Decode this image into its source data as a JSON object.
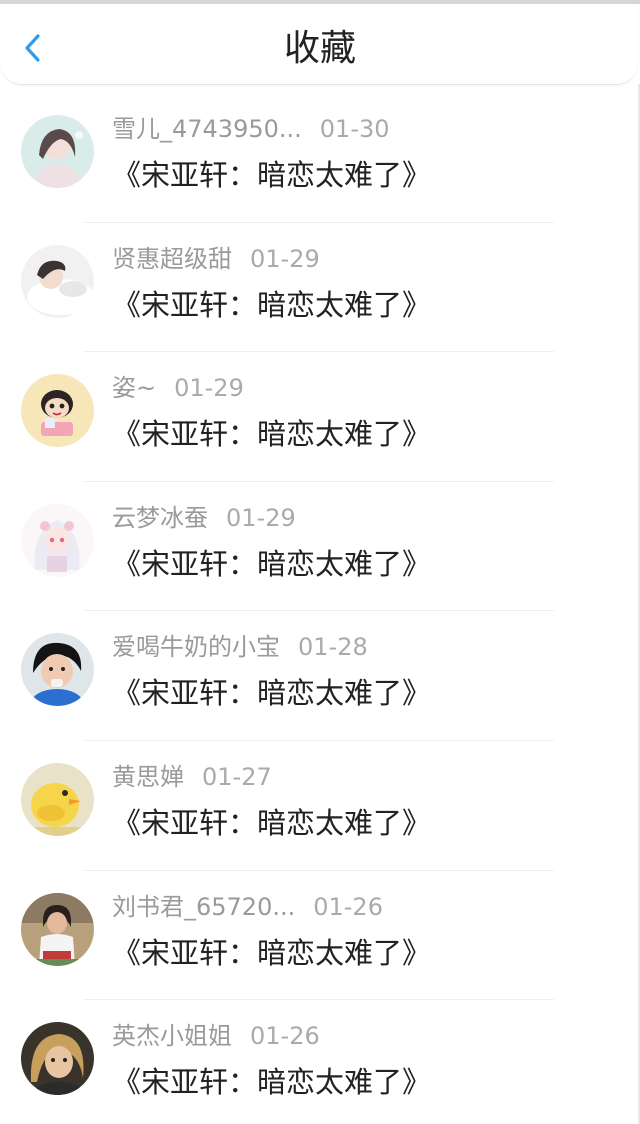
{
  "header": {
    "title": "收藏"
  },
  "accent_color": "#2f9bf0",
  "items": [
    {
      "user": "雪儿_4743950...",
      "date": "01-30",
      "title": "《宋亚轩：暗恋太难了》",
      "avatar": "avatar-girl-pale"
    },
    {
      "user": "贤惠超级甜",
      "date": "01-29",
      "title": "《宋亚轩：暗恋太难了》",
      "avatar": "avatar-sleeping-person"
    },
    {
      "user": "姿~",
      "date": "01-29",
      "title": "《宋亚轩：暗恋太难了》",
      "avatar": "avatar-cartoon-character"
    },
    {
      "user": "云梦冰蚕",
      "date": "01-29",
      "title": "《宋亚轩：暗恋太难了》",
      "avatar": "avatar-anime-girl"
    },
    {
      "user": "爱喝牛奶的小宝",
      "date": "01-28",
      "title": "《宋亚轩：暗恋太难了》",
      "avatar": "avatar-boy"
    },
    {
      "user": "黄思婵",
      "date": "01-27",
      "title": "《宋亚轩：暗恋太难了》",
      "avatar": "avatar-yellow-duck"
    },
    {
      "user": "刘书君_65720...",
      "date": "01-26",
      "title": "《宋亚轩：暗恋太难了》",
      "avatar": "avatar-child"
    },
    {
      "user": "英杰小姐姐",
      "date": "01-26",
      "title": "《宋亚轩：暗恋太难了》",
      "avatar": "avatar-blonde-person"
    }
  ]
}
